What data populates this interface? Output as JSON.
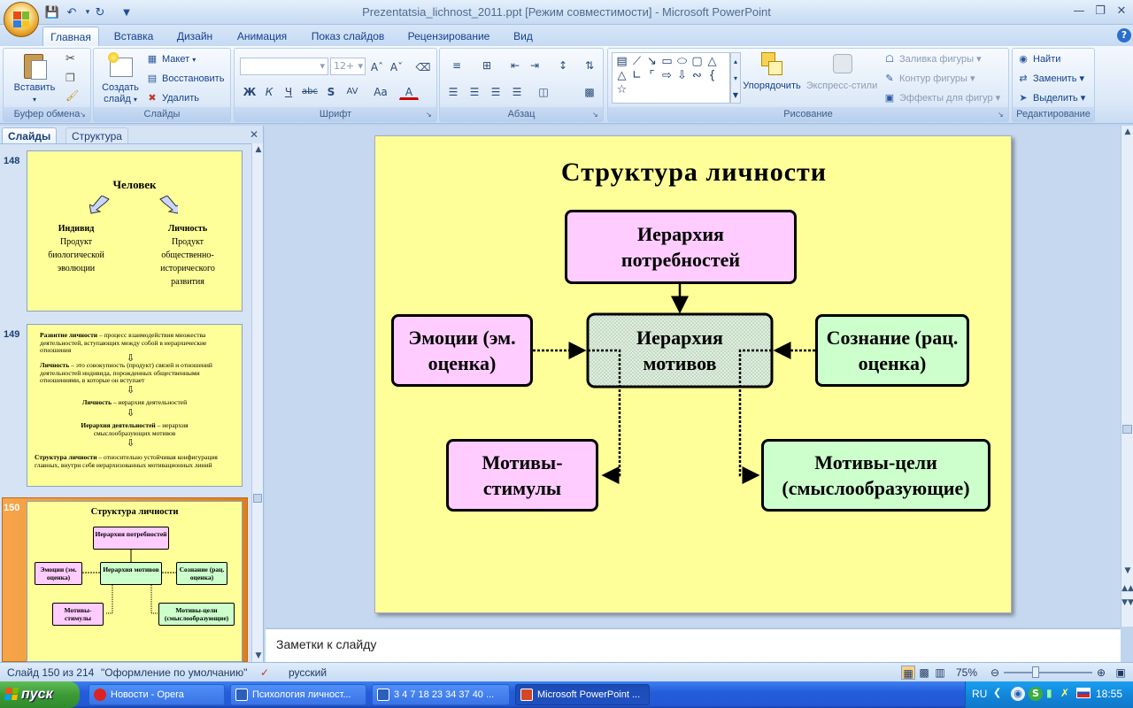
{
  "window": {
    "title": "Prezentatsia_lichnost_2011.ppt [Режим совместимости] - Microsoft PowerPoint"
  },
  "ribbon": {
    "tabs": [
      "Главная",
      "Вставка",
      "Дизайн",
      "Анимация",
      "Показ слайдов",
      "Рецензирование",
      "Вид"
    ],
    "active_tab": "Главная",
    "clipboard": {
      "label": "Буфер обмена",
      "paste": "Вставить"
    },
    "slides": {
      "label": "Слайды",
      "create": "Создать слайд",
      "layout": "Макет",
      "reset": "Восстановить",
      "delete": "Удалить"
    },
    "font": {
      "label": "Шрифт",
      "size": "12+"
    },
    "paragraph": {
      "label": "Абзац"
    },
    "drawing": {
      "label": "Рисование",
      "arrange": "Упорядочить",
      "express": "Экспресс-стили",
      "fill": "Заливка фигуры",
      "outline": "Контур фигуры",
      "effects": "Эффекты для фигур"
    },
    "editing": {
      "label": "Редактирование",
      "find": "Найти",
      "replace": "Заменить",
      "select": "Выделить"
    }
  },
  "pane": {
    "tab_slides": "Слайды",
    "tab_structure": "Структура"
  },
  "thumbs": {
    "t148": {
      "num": "148",
      "title": "Человек",
      "left_head": "Индивид",
      "left_body": "Продукт биологической эволюции",
      "right_head": "Личность",
      "right_body": "Продукт общественно-исторического развития"
    },
    "t149": {
      "num": "149",
      "p1_b": "Развитие личности",
      "p1": " – процесс взаимодействия множества деятельностей, вступающих между собой в иерархические отношения",
      "p2_b": "Личность",
      "p2": " – это совокупность (продукт) связей и отношений деятельностей индивида, порожденных общественными отношениями, в которые он вступает",
      "p3_b": "Личность",
      "p3": " – иерархия деятельностей",
      "p4_b": "Иерархия деятельностей",
      "p4": " – иерархия смыслообразующих мотивов",
      "p5_b": "Структура личности",
      "p5": " – относительно устойчивая конфигурация главных, внутри себя иерархизованных мотивационных линий"
    },
    "t150": {
      "num": "150"
    }
  },
  "slide": {
    "title": "Структура личности",
    "needs": "Иерархия потребностей",
    "motives": "Иерархия мотивов",
    "emotions": "Эмоции (эм. оценка)",
    "consciousness": "Сознание (рац. оценка)",
    "stimuli": "Мотивы-стимулы",
    "goals": "Мотивы-цели (смыслообразующие)",
    "colors": {
      "background": "#ffff99",
      "pink": "#ffccff",
      "green": "#ccffcc",
      "center": "#ccffcc"
    }
  },
  "notes": {
    "placeholder": "Заметки к слайду"
  },
  "status": {
    "slide_counter": "Слайд 150 из 214",
    "theme": "\"Оформление по умолчанию\"",
    "language": "русский",
    "zoom": "75%"
  },
  "taskbar": {
    "start": "пуск",
    "tasks": [
      "Новости - Opera",
      "Психология личност...",
      "3 4 7 18 23 34 37 40 ...",
      "Microsoft PowerPoint ..."
    ],
    "lang": "RU",
    "clock": "18:55"
  }
}
